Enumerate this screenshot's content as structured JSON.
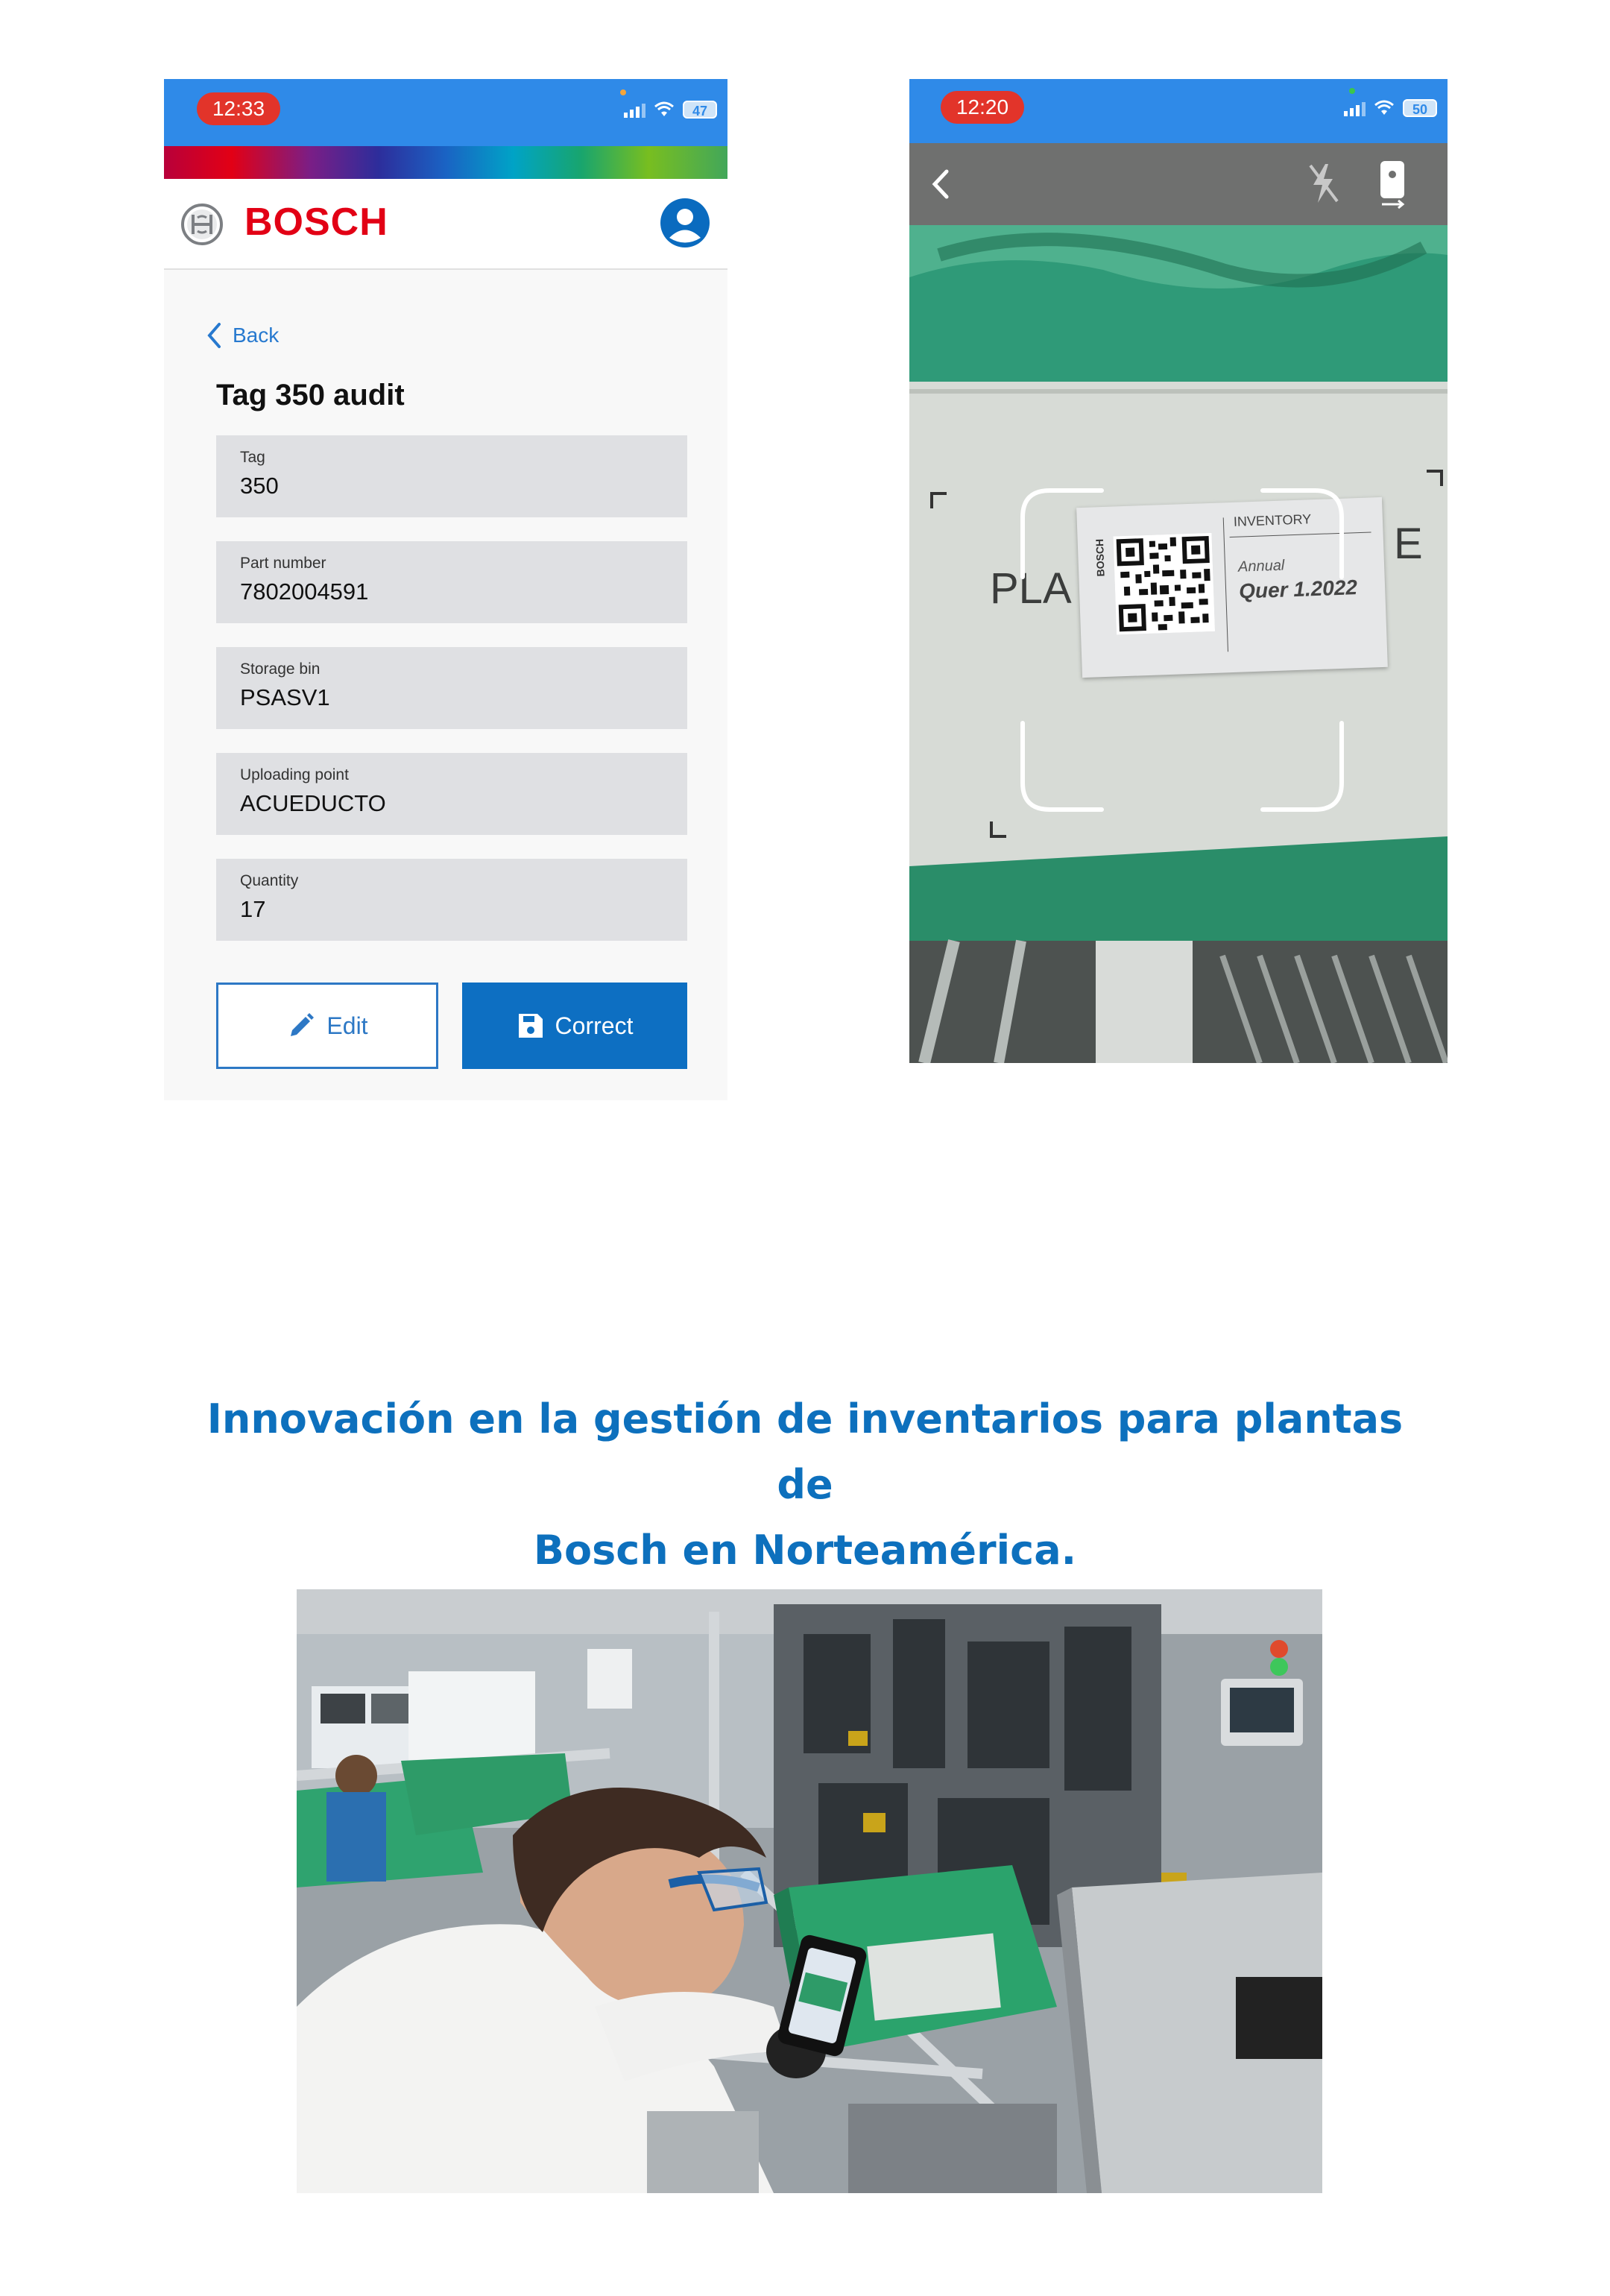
{
  "phone1": {
    "status": {
      "time": "12:33",
      "battery": "47"
    },
    "brand": "BOSCH",
    "back_label": "Back",
    "title": "Tag 350 audit",
    "fields": [
      {
        "label": "Tag",
        "value": "350"
      },
      {
        "label": "Part number",
        "value": "7802004591"
      },
      {
        "label": "Storage bin",
        "value": "PSASV1"
      },
      {
        "label": "Uploading point",
        "value": "ACUEDUCTO"
      },
      {
        "label": "Quantity",
        "value": "17"
      }
    ],
    "buttons": {
      "edit": "Edit",
      "correct": "Correct"
    },
    "icons": [
      "bosch-logo-icon",
      "account-icon",
      "chevron-left-icon",
      "pencil-icon",
      "save-icon"
    ],
    "colors": {
      "brand_red": "#e20015",
      "primary": "#0d6fc2",
      "status_bar": "#2f8ae8"
    }
  },
  "phone2": {
    "status": {
      "time": "12:20",
      "battery": "50"
    },
    "icons": [
      "chevron-left-icon",
      "flash-off-icon",
      "switch-camera-icon"
    ],
    "tag_label": {
      "header": "INVENTORY",
      "brand": "BOSCH",
      "handwriting_1": "Annual",
      "handwriting_2": "Quer 1.2022",
      "bin_text_left": "PLA",
      "bin_text_right": "E"
    }
  },
  "headline": {
    "line1": "Innovación en la gestión de inventarios para plantas de",
    "line2": "Bosch en Norteamérica."
  }
}
